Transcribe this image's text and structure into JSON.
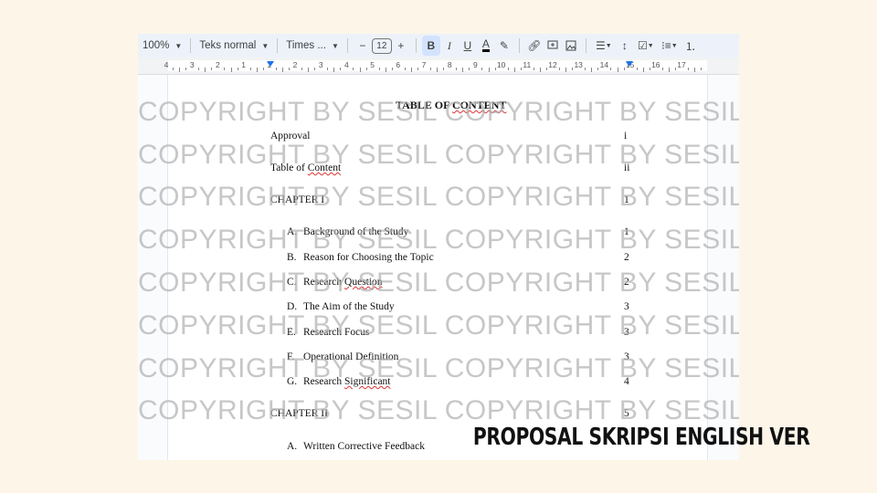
{
  "toolbar": {
    "zoom": "100%",
    "style": "Teks normal",
    "font": "Times ...",
    "font_size": "12",
    "minus": "−",
    "plus": "+",
    "bold": "B",
    "italic": "I",
    "underline": "U",
    "text_color": "A"
  },
  "ruler": {
    "labels": [
      "4",
      "3",
      "2",
      "1",
      "1",
      "2",
      "3",
      "4",
      "5",
      "6",
      "7",
      "8",
      "9",
      "10",
      "11",
      "12",
      "13",
      "14",
      "15",
      "16",
      "17"
    ]
  },
  "document": {
    "title": "TABLE OF CONTENT",
    "entries": [
      {
        "label": "Approval",
        "page": "i"
      },
      {
        "label": "Table of Content",
        "page": "ii"
      },
      {
        "label": "CHAPTER I",
        "page": "1"
      },
      {
        "letter": "A.",
        "label": "Background of the Study",
        "page": "1"
      },
      {
        "letter": "B.",
        "label": "Reason for Choosing the Topic",
        "page": "2"
      },
      {
        "letter": "C.",
        "label": "Research Question",
        "page": "2"
      },
      {
        "letter": "D.",
        "label": "The Aim of the Study",
        "page": "3"
      },
      {
        "letter": "E.",
        "label": "Research Focus",
        "page": "3"
      },
      {
        "letter": "F.",
        "label": "Operational Definition",
        "page": "3"
      },
      {
        "letter": "G.",
        "label": "Research Significant",
        "page": "4"
      },
      {
        "label": "CHAPTER II",
        "page": "5"
      },
      {
        "letter": "A.",
        "label": "Written Corrective Feedback",
        "page": ""
      }
    ]
  },
  "watermark": "COPYRIGHT BY SESIL COPYRIGHT BY SESIL",
  "caption": "PROPOSAL SKRIPSI ENGLISH VER",
  "colors": {
    "background": "#fdf6e8",
    "toolbar": "#edf2fa",
    "bold_active": "#d3e3fd"
  }
}
